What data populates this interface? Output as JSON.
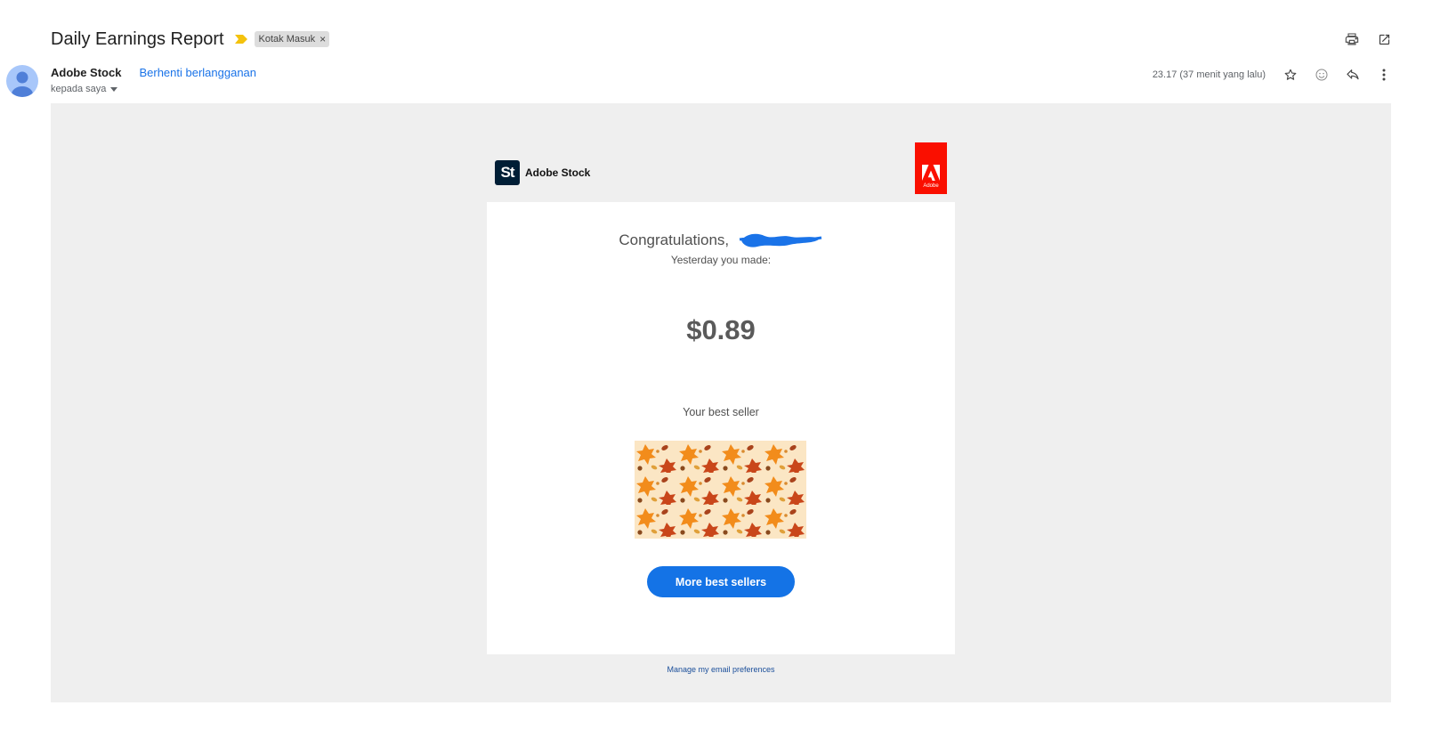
{
  "email": {
    "subject": "Daily Earnings Report",
    "label": "Kotak Masuk",
    "label_remove": "×",
    "sender": "Adobe Stock",
    "unsubscribe": "Berhenti berlangganan",
    "recipient": "kepada saya",
    "timestamp": "23.17 (37 menit yang lalu)"
  },
  "icons": {
    "importance": "importance-marker-icon",
    "print": "print-icon",
    "open_new": "open-in-new-window-icon",
    "star": "star-icon",
    "emoji": "emoji-reaction-icon",
    "reply": "reply-icon",
    "more": "more-vertical-icon",
    "avatar": "avatar-person-icon",
    "dropdown": "chevron-down-icon"
  },
  "colors": {
    "accent_link": "#1a73e8",
    "cta": "#1473e6",
    "adobe_red": "#fa0f00",
    "stock_logo": "#001e36",
    "redaction": "#1a73e8"
  },
  "body": {
    "brand_mark": "St",
    "brand_name": "Adobe Stock",
    "adobe_badge": "Adobe",
    "congrats": "Congratulations,",
    "yesterday": "Yesterday you made:",
    "amount": "$0.89",
    "best_seller_label": "Your best seller",
    "cta": "More best sellers",
    "preferences": "Manage my email preferences"
  }
}
